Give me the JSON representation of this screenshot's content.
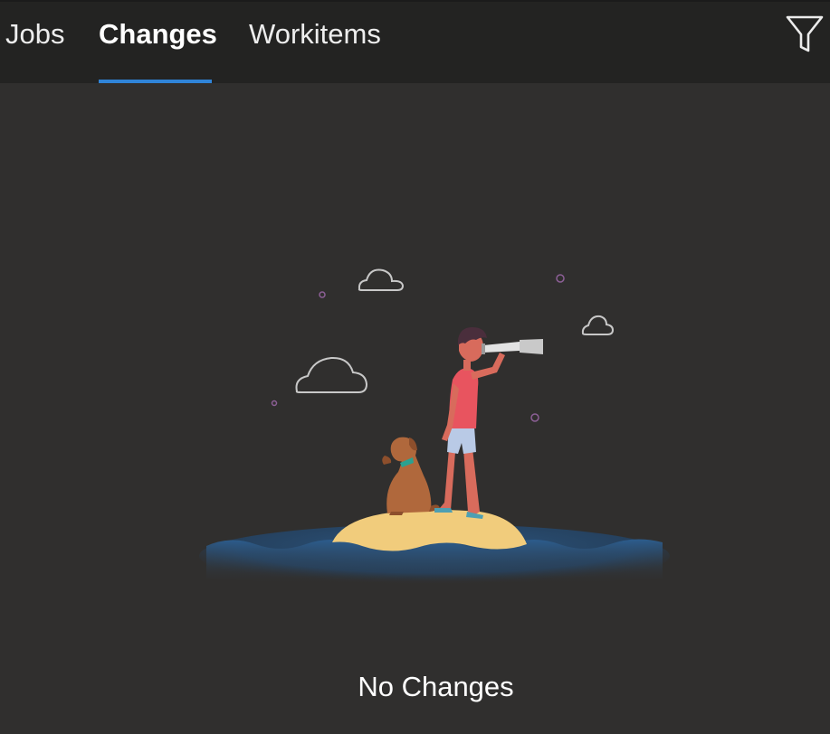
{
  "tabs": {
    "jobs": "Jobs",
    "changes": "Changes",
    "workitems": "Workitems",
    "active": "Changes",
    "accent_color": "#2f84d8"
  },
  "toolbar": {
    "filter_icon": "filter-funnel-icon"
  },
  "empty_state": {
    "message": "No Changes",
    "illustration": "person-with-telescope-and-dog-on-island"
  },
  "colors": {
    "tabbar_bg": "#232322",
    "page_bg": "#302f2e",
    "sand": "#f1cc7c",
    "water": "#2a5d8f",
    "shirt": "#e8545f",
    "dog": "#b0683c"
  }
}
